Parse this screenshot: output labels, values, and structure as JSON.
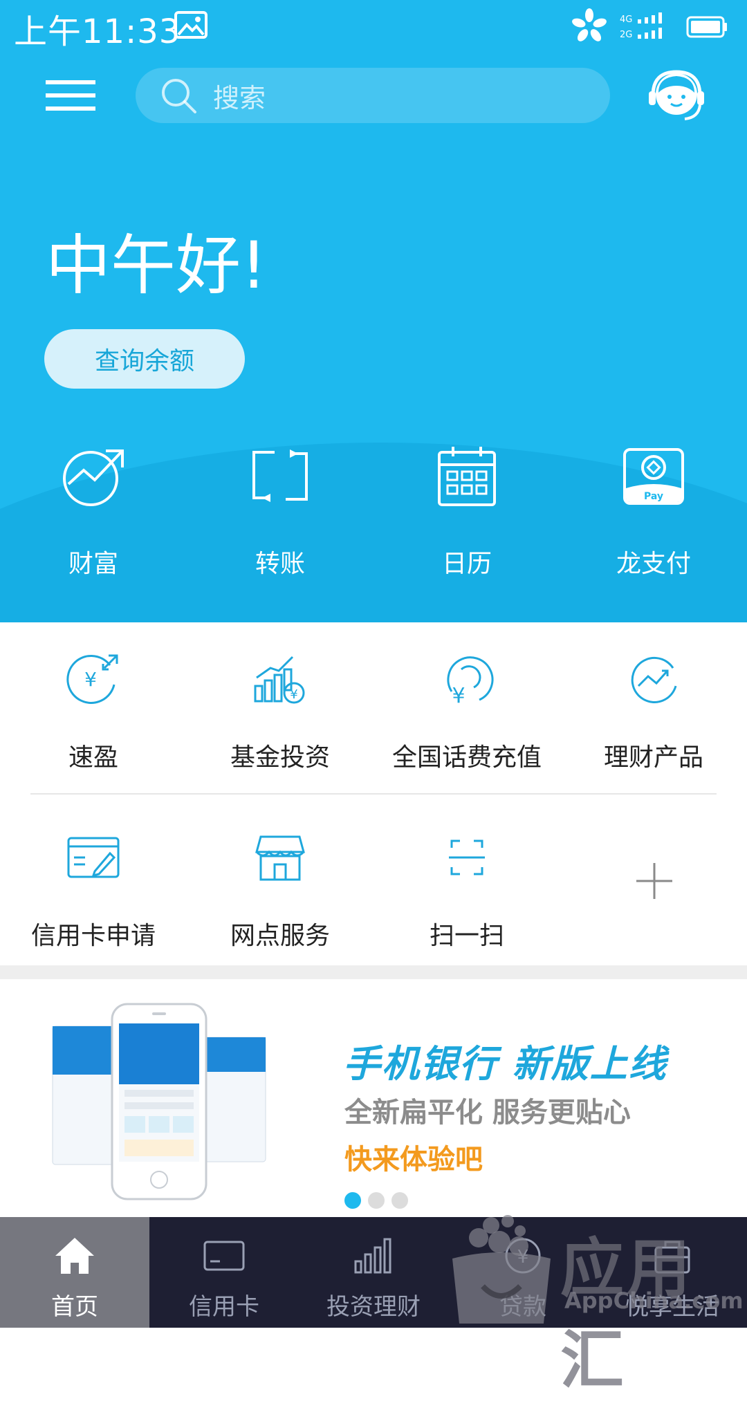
{
  "status_bar": {
    "time": "上午11:33",
    "network_4g": "4G",
    "network_2g": "2G"
  },
  "header": {
    "search_placeholder": "搜索"
  },
  "greeting": "中午好!",
  "balance_button": "查询余额",
  "quick_actions": [
    {
      "label": "财富",
      "icon": "wealth-arrow-icon"
    },
    {
      "label": "转账",
      "icon": "transfer-icon"
    },
    {
      "label": "日历",
      "icon": "calendar-icon"
    },
    {
      "label": "龙支付",
      "icon": "long-pay-icon",
      "badge": "Pay"
    }
  ],
  "services_row1": [
    {
      "label": "速盈",
      "icon": "yuan-exchange-icon"
    },
    {
      "label": "基金投资",
      "icon": "fund-chart-icon"
    },
    {
      "label": "全国话费充值",
      "icon": "phone-recharge-icon"
    },
    {
      "label": "理财产品",
      "icon": "finance-trend-icon"
    }
  ],
  "services_row2": [
    {
      "label": "信用卡申请",
      "icon": "credit-card-apply-icon"
    },
    {
      "label": "网点服务",
      "icon": "branch-store-icon"
    },
    {
      "label": "扫一扫",
      "icon": "scan-icon"
    }
  ],
  "banner": {
    "title": "手机银行  新版上线",
    "subtitle": "全新扁平化  服务更贴心",
    "cta": "快来体验吧"
  },
  "tabs": [
    {
      "label": "首页",
      "icon": "home-icon",
      "active": true
    },
    {
      "label": "信用卡",
      "icon": "credit-card-icon",
      "active": false
    },
    {
      "label": "投资理财",
      "icon": "bar-chart-icon",
      "active": false
    },
    {
      "label": "贷款",
      "icon": "loan-icon",
      "active": false
    },
    {
      "label": "悦享生活",
      "icon": "life-icon",
      "active": false
    }
  ],
  "watermark": {
    "cn": "应用汇",
    "en": "AppChina.com"
  },
  "colors": {
    "primary": "#1eb9ee",
    "tabbar": "#1e1f33",
    "accent_orange": "#f39a1e"
  }
}
